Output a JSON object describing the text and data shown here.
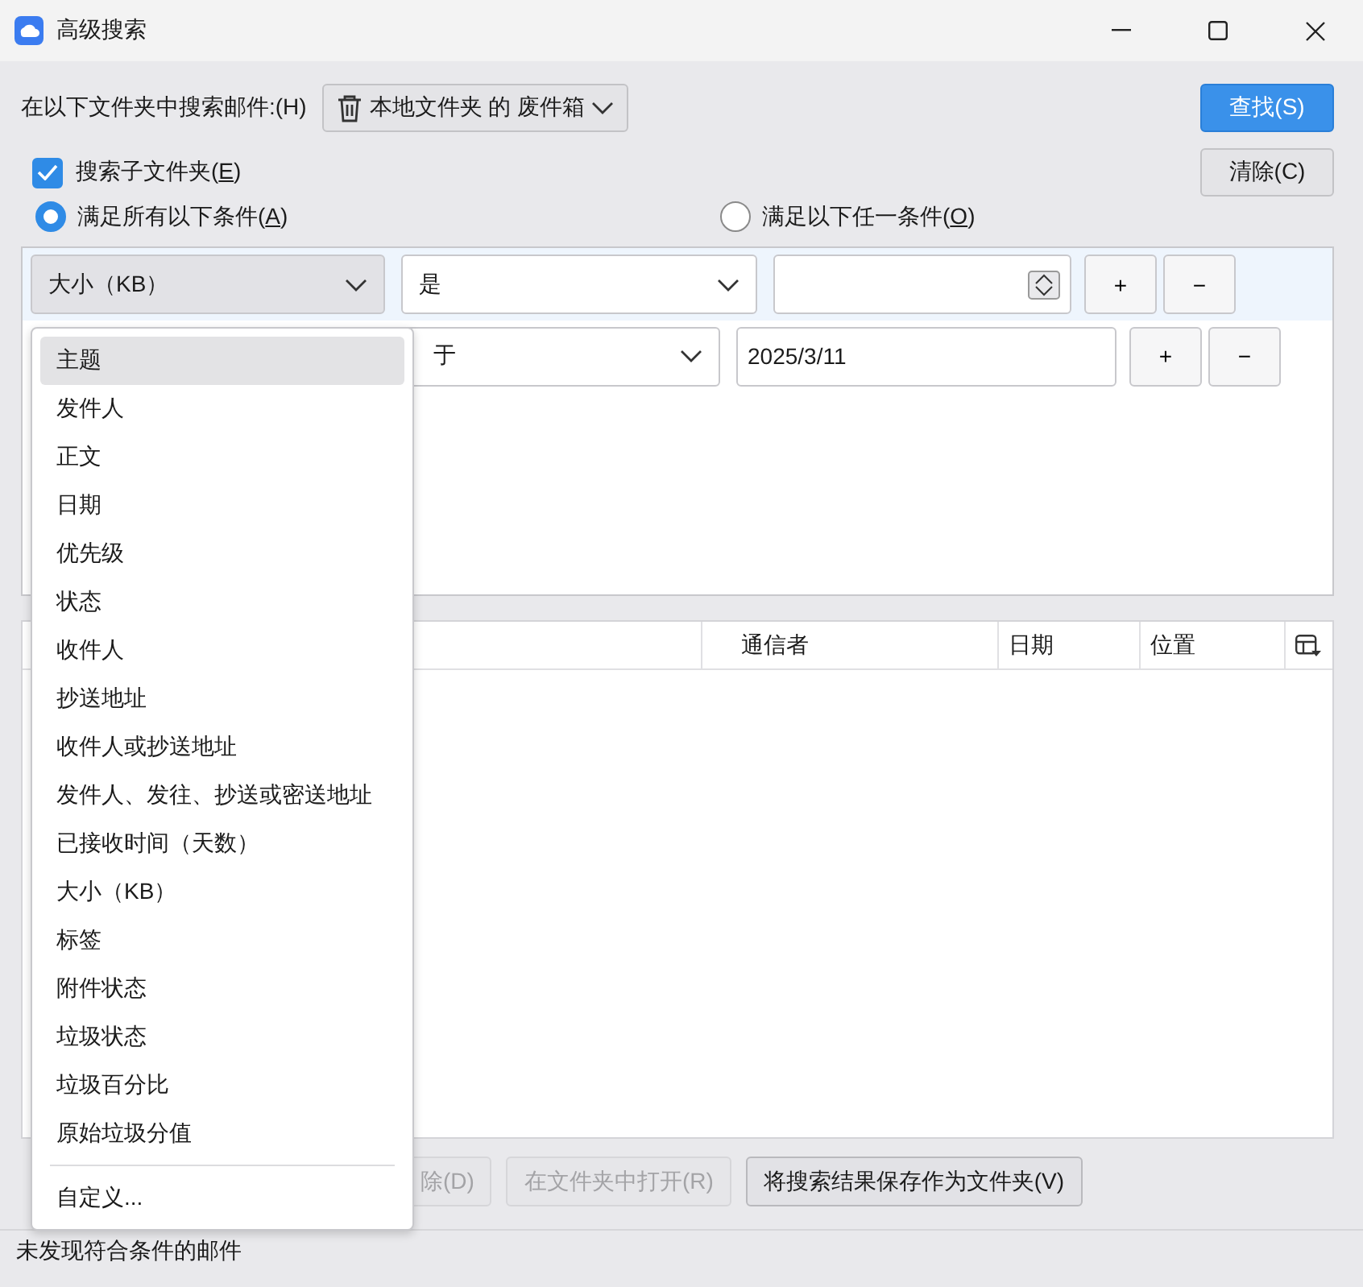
{
  "window": {
    "title": "高级搜索"
  },
  "search_in": {
    "label": "在以下文件夹中搜索邮件:(H)",
    "folder": "本地文件夹 的 废件箱"
  },
  "buttons": {
    "find": "查找(S)",
    "clear": "清除(C)"
  },
  "subfolders": {
    "text": "搜索子文件夹(",
    "mnemonic": "E",
    "after": ")",
    "checked": true
  },
  "match": [
    {
      "text": "满足所有以下条件(",
      "mnemonic": "A",
      "after": ")",
      "selected": true
    },
    {
      "text": "满足以下任一条件(",
      "mnemonic": "O",
      "after": ")",
      "selected": false
    }
  ],
  "conditions": [
    {
      "kind": "number",
      "field": "大小（KB）",
      "open": true,
      "operator": "是",
      "add": "+",
      "remove": "−",
      "selected": true
    },
    {
      "kind": "date",
      "operator": "于",
      "value": "2025/3/11",
      "add": "+",
      "remove": "−",
      "selected": false
    }
  ],
  "results": {
    "columns": [
      "通信者",
      "日期",
      "位置"
    ]
  },
  "actions": [
    {
      "label": "除(D)",
      "disabled": true
    },
    {
      "label": "在文件夹中打开(R)",
      "disabled": true
    },
    {
      "label": "将搜索结果保存作为文件夹(V)",
      "disabled": false
    }
  ],
  "dropdown": {
    "items": [
      {
        "label": "主题",
        "selected": true
      },
      {
        "label": "发件人",
        "selected": false
      },
      {
        "label": "正文",
        "selected": false
      },
      {
        "label": "日期",
        "selected": false
      },
      {
        "label": "优先级",
        "selected": false
      },
      {
        "label": "状态",
        "selected": false
      },
      {
        "label": "收件人",
        "selected": false
      },
      {
        "label": "抄送地址",
        "selected": false
      },
      {
        "label": "收件人或抄送地址",
        "selected": false
      },
      {
        "label": "发件人、发往、抄送或密送地址",
        "selected": false
      },
      {
        "label": "已接收时间（天数）",
        "selected": false
      },
      {
        "label": "大小（KB）",
        "selected": false
      },
      {
        "label": "标签",
        "selected": false
      },
      {
        "label": "附件状态",
        "selected": false
      },
      {
        "label": "垃圾状态",
        "selected": false
      },
      {
        "label": "垃圾百分比",
        "selected": false
      },
      {
        "label": "原始垃圾分值",
        "selected": false
      }
    ],
    "footer": "自定义..."
  },
  "status_bar": "未发现符合条件的邮件"
}
